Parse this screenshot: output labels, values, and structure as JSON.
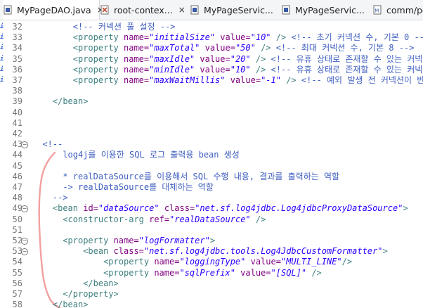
{
  "tabs": [
    {
      "label": "MyPageDAO.java",
      "icon": "java-file-icon",
      "closable": true,
      "active": true
    },
    {
      "label": "root-contex...",
      "icon": "xml-file-icon",
      "closable": true,
      "active": false
    },
    {
      "label": "MyPageServic...",
      "icon": "java-file-icon",
      "closable": false,
      "active": false
    },
    {
      "label": "MyPageServic...",
      "icon": "java-file-icon",
      "closable": false,
      "active": false
    },
    {
      "label": "comm/po",
      "icon": "mapper-file-icon",
      "closable": false,
      "active": false
    }
  ],
  "close_glyph": "×",
  "lines": [
    {
      "n": "32",
      "indent": 8,
      "fold": false,
      "marker": "i",
      "tokens": [
        [
          "c",
          "<!-- 커넥션 풀 설정 -->"
        ]
      ]
    },
    {
      "n": "33",
      "indent": 8,
      "fold": false,
      "marker": "i",
      "tokens": [
        [
          "t",
          "<property "
        ],
        [
          "a",
          "name="
        ],
        [
          "v",
          "\"initialSize\""
        ],
        [
          "a",
          " value="
        ],
        [
          "v",
          "\"10\""
        ],
        [
          "t",
          " /> "
        ],
        [
          "c",
          "<!-- 초기 커넥션 수, 기본 0 -->"
        ]
      ]
    },
    {
      "n": "34",
      "indent": 8,
      "fold": false,
      "marker": "i",
      "tokens": [
        [
          "t",
          "<property "
        ],
        [
          "a",
          "name="
        ],
        [
          "v",
          "\"maxTotal\""
        ],
        [
          "a",
          " value="
        ],
        [
          "v",
          "\"50\""
        ],
        [
          "t",
          " /> "
        ],
        [
          "c",
          "<!-- 최대 커넥션 수, 기본 8 -->"
        ]
      ]
    },
    {
      "n": "35",
      "indent": 8,
      "fold": false,
      "marker": "i",
      "tokens": [
        [
          "t",
          "<property "
        ],
        [
          "a",
          "name="
        ],
        [
          "v",
          "\"maxIdle\""
        ],
        [
          "a",
          " value="
        ],
        [
          "v",
          "\"20\""
        ],
        [
          "t",
          " /> "
        ],
        [
          "c",
          "<!-- 유휴 상태로 존재할 수 있는 커넥션"
        ]
      ]
    },
    {
      "n": "36",
      "indent": 8,
      "fold": false,
      "marker": "i",
      "tokens": [
        [
          "t",
          "<property "
        ],
        [
          "a",
          "name="
        ],
        [
          "v",
          "\"minIdle\""
        ],
        [
          "a",
          " value="
        ],
        [
          "v",
          "\"10\""
        ],
        [
          "t",
          " /> "
        ],
        [
          "c",
          "<!-- 유휴 상태로 존재할 수 있는 커넥션"
        ]
      ]
    },
    {
      "n": "37",
      "indent": 8,
      "fold": false,
      "marker": "i",
      "tokens": [
        [
          "t",
          "<property "
        ],
        [
          "a",
          "name="
        ],
        [
          "v",
          "\"maxWaitMillis\""
        ],
        [
          "a",
          " value="
        ],
        [
          "v",
          "\"-1\""
        ],
        [
          "t",
          " /> "
        ],
        [
          "c",
          "<!-- 예외 발생 전 커넥션이 반"
        ]
      ]
    },
    {
      "n": "38",
      "indent": 0,
      "fold": false,
      "marker": "",
      "tokens": []
    },
    {
      "n": "39",
      "indent": 4,
      "fold": false,
      "marker": "",
      "tokens": [
        [
          "t",
          "</bean>"
        ]
      ]
    },
    {
      "n": "40",
      "indent": 0,
      "fold": false,
      "marker": "",
      "tokens": []
    },
    {
      "n": "41",
      "indent": 0,
      "fold": false,
      "marker": "",
      "tokens": []
    },
    {
      "n": "42",
      "indent": 0,
      "fold": false,
      "marker": "",
      "tokens": []
    },
    {
      "n": "43",
      "indent": 2,
      "fold": true,
      "marker": "",
      "tokens": [
        [
          "c",
          "<!--"
        ]
      ]
    },
    {
      "n": "44",
      "indent": 6,
      "fold": false,
      "marker": "",
      "tokens": [
        [
          "c",
          "log4j를 이용한 SQL 로그 출력용 bean 생성"
        ]
      ]
    },
    {
      "n": "45",
      "indent": 0,
      "fold": false,
      "marker": "",
      "tokens": []
    },
    {
      "n": "46",
      "indent": 6,
      "fold": false,
      "marker": "",
      "tokens": [
        [
          "c",
          "* realDataSource를 이용해서 SQL 수행 내용, 결과를 출력하는 역할"
        ]
      ]
    },
    {
      "n": "47",
      "indent": 6,
      "fold": false,
      "marker": "",
      "tokens": [
        [
          "c",
          "-> realDataSource를 대체하는 역할"
        ]
      ]
    },
    {
      "n": "48",
      "indent": 4,
      "fold": false,
      "marker": "",
      "tokens": [
        [
          "c",
          "-->"
        ]
      ]
    },
    {
      "n": "49",
      "indent": 4,
      "fold": true,
      "marker": "",
      "tokens": [
        [
          "t",
          "<bean "
        ],
        [
          "a",
          "id="
        ],
        [
          "v",
          "\"dataSource\""
        ],
        [
          "a",
          " class="
        ],
        [
          "v",
          "\"net.sf.log4jdbc.Log4jdbcProxyDataSource\""
        ],
        [
          "t",
          ">"
        ]
      ]
    },
    {
      "n": "50",
      "indent": 6,
      "fold": false,
      "marker": "",
      "tokens": [
        [
          "t",
          "<constructor-arg "
        ],
        [
          "a",
          "ref="
        ],
        [
          "v",
          "\"realDataSource\""
        ],
        [
          "t",
          " />"
        ]
      ]
    },
    {
      "n": "51",
      "indent": 0,
      "fold": false,
      "marker": "",
      "tokens": []
    },
    {
      "n": "52",
      "indent": 6,
      "fold": true,
      "marker": "",
      "tokens": [
        [
          "t",
          "<property "
        ],
        [
          "a",
          "name="
        ],
        [
          "v",
          "\"logFormatter\""
        ],
        [
          "t",
          ">"
        ]
      ]
    },
    {
      "n": "53",
      "indent": 10,
      "fold": true,
      "marker": "",
      "tokens": [
        [
          "t",
          "<bean "
        ],
        [
          "a",
          "class="
        ],
        [
          "v",
          "\"net.sf.log4jdbc.tools.Log4JdbcCustomFormatter\""
        ],
        [
          "t",
          ">"
        ]
      ]
    },
    {
      "n": "54",
      "indent": 14,
      "fold": false,
      "marker": "",
      "tokens": [
        [
          "t",
          "<property "
        ],
        [
          "a",
          "name="
        ],
        [
          "v",
          "\"loggingType\""
        ],
        [
          "a",
          " value="
        ],
        [
          "v",
          "\"MULTI_LINE\""
        ],
        [
          "t",
          "/>"
        ]
      ]
    },
    {
      "n": "55",
      "indent": 14,
      "fold": false,
      "marker": "",
      "tokens": [
        [
          "t",
          "<property "
        ],
        [
          "a",
          "name="
        ],
        [
          "v",
          "\"sqlPrefix\""
        ],
        [
          "a",
          " value="
        ],
        [
          "v",
          "\"[SQL]\""
        ],
        [
          "t",
          " />"
        ]
      ]
    },
    {
      "n": "56",
      "indent": 10,
      "fold": false,
      "marker": "",
      "tokens": [
        [
          "t",
          "</bean>"
        ]
      ]
    },
    {
      "n": "57",
      "indent": 6,
      "fold": false,
      "marker": "",
      "tokens": [
        [
          "t",
          "</property>"
        ]
      ]
    },
    {
      "n": "58",
      "indent": 4,
      "fold": false,
      "marker": "",
      "tokens": [
        [
          "t",
          "</bean>"
        ]
      ]
    }
  ]
}
